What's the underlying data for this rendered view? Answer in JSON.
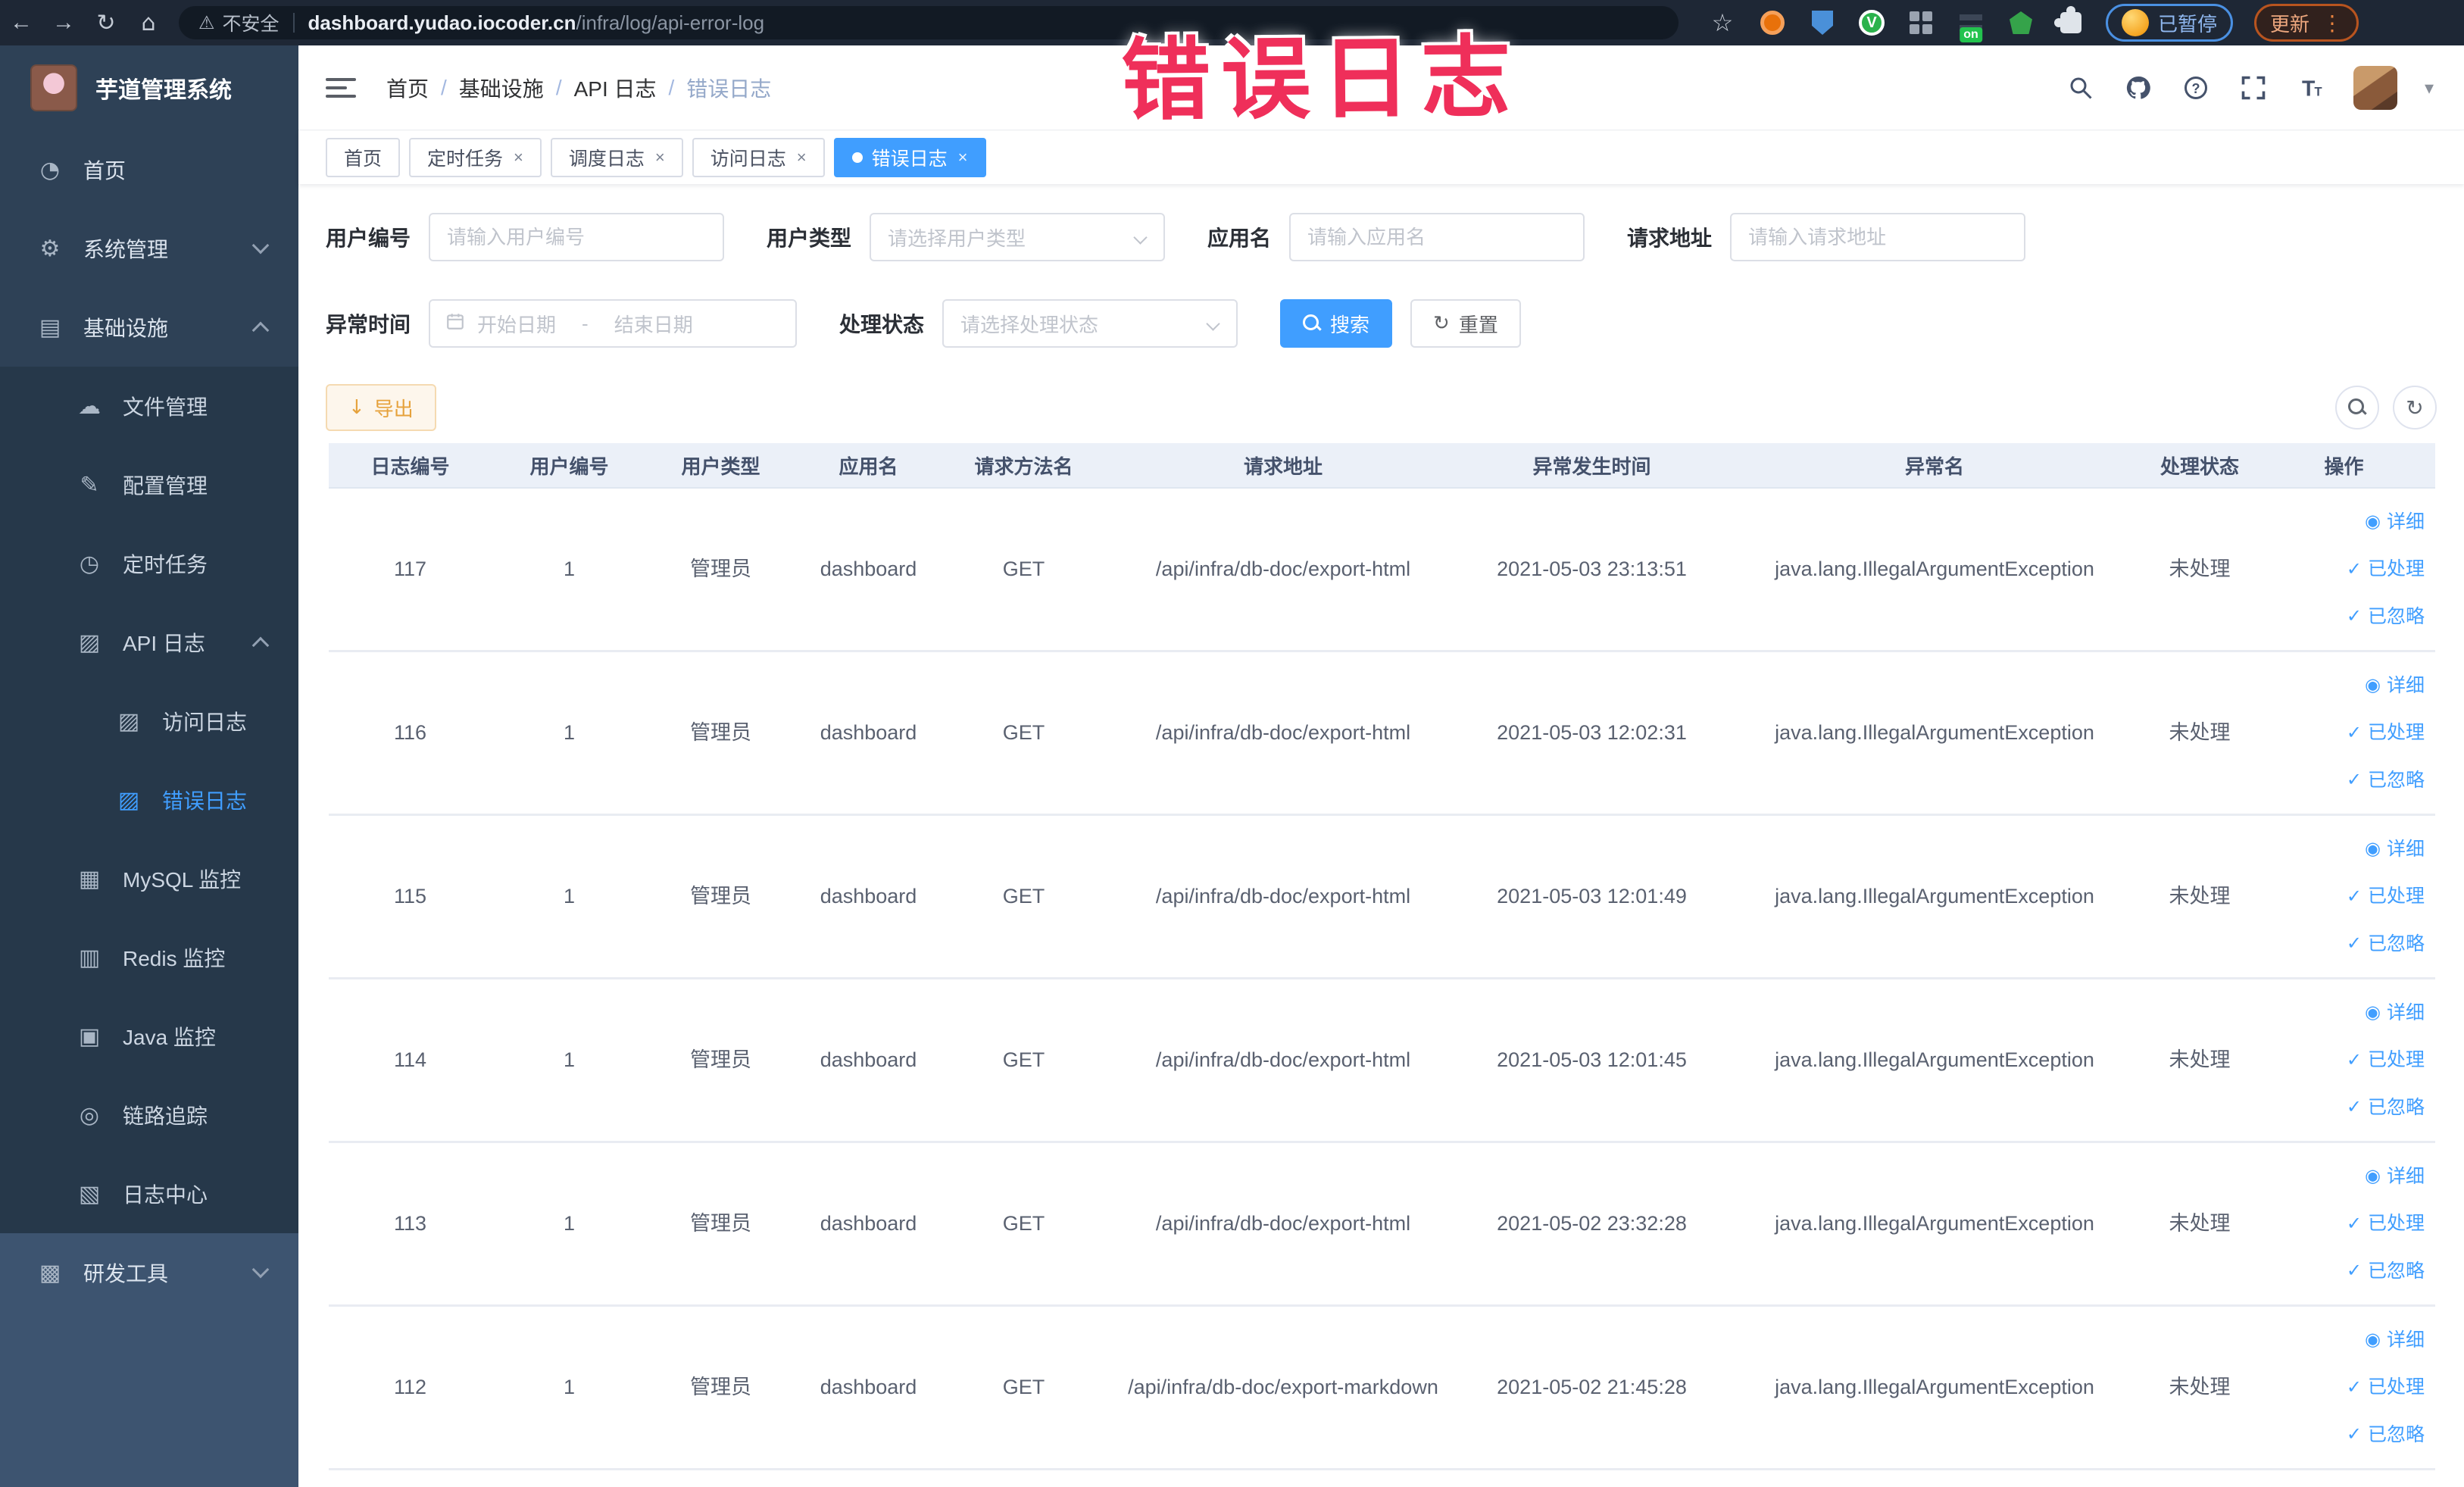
{
  "colors": {
    "accent": "#409eff",
    "warning": "#e6a23c",
    "annotation_red": "#ef2f5a",
    "chrome_bar": "#1e2735",
    "sidebar_dark": "#2e4156",
    "sidebar_submenu": "#26384a",
    "sidebar_light": "#3d5470",
    "table_header_bg": "#ebf0f8"
  },
  "annotation": {
    "text": "错误日志"
  },
  "browser": {
    "security_label": "不安全",
    "url_host": "dashboard.yudao.iocoder.cn",
    "url_path": "/infra/log/api-error-log",
    "extension_on_badge": "on",
    "paused_label": "已暂停",
    "update_label": "更新",
    "kebab": "⋮",
    "back_glyph": "←",
    "forward_glyph": "→",
    "reload_glyph": "↻",
    "home_glyph": "⌂",
    "warning_glyph": "⚠"
  },
  "sidebar": {
    "app_title": "芋道管理系统",
    "items": [
      {
        "key": "home",
        "label": "首页",
        "icon": "dashboard-icon",
        "glyph": "◔",
        "level": 0
      },
      {
        "key": "system-mgmt",
        "label": "系统管理",
        "icon": "gear-icon",
        "glyph": "⚙",
        "level": 0,
        "arrow": "down"
      },
      {
        "key": "infrastructure",
        "label": "基础设施",
        "icon": "infrastructure-icon",
        "glyph": "▤",
        "level": 0,
        "arrow": "up"
      },
      {
        "key": "file-mgmt",
        "label": "文件管理",
        "icon": "cloud-upload-icon",
        "glyph": "☁",
        "level": 1
      },
      {
        "key": "config-mgmt",
        "label": "配置管理",
        "icon": "edit-icon",
        "glyph": "✎",
        "level": 1
      },
      {
        "key": "scheduled-tasks",
        "label": "定时任务",
        "icon": "timer-icon",
        "glyph": "◷",
        "level": 1
      },
      {
        "key": "api-log",
        "label": "API 日志",
        "icon": "api-log-icon",
        "glyph": "▨",
        "level": 1,
        "arrow": "up"
      },
      {
        "key": "access-log",
        "label": "访问日志",
        "icon": "access-log-icon",
        "glyph": "▨",
        "level": 2
      },
      {
        "key": "error-log",
        "label": "错误日志",
        "icon": "error-log-icon",
        "glyph": "▨",
        "level": 2,
        "active": true
      },
      {
        "key": "mysql-monitor",
        "label": "MySQL 监控",
        "icon": "mysql-monitor-icon",
        "glyph": "▦",
        "level": 1
      },
      {
        "key": "redis-monitor",
        "label": "Redis 监控",
        "icon": "redis-monitor-icon",
        "glyph": "▥",
        "level": 1
      },
      {
        "key": "java-monitor",
        "label": "Java 监控",
        "icon": "java-monitor-icon",
        "glyph": "▣",
        "level": 1
      },
      {
        "key": "trace",
        "label": "链路追踪",
        "icon": "trace-eye-icon",
        "glyph": "◎",
        "level": 1
      },
      {
        "key": "log-center",
        "label": "日志中心",
        "icon": "log-center-icon",
        "glyph": "▧",
        "level": 1
      },
      {
        "key": "dev-tools",
        "label": "研发工具",
        "icon": "dev-tools-icon",
        "glyph": "▩",
        "level": 0,
        "arrow": "down",
        "light": true
      }
    ]
  },
  "breadcrumb": {
    "items": [
      "首页",
      "基础设施",
      "API 日志",
      "错误日志"
    ],
    "separator": "/"
  },
  "tabs": {
    "items": [
      {
        "label": "首页",
        "closable": false,
        "active": false
      },
      {
        "label": "定时任务",
        "closable": true,
        "active": false
      },
      {
        "label": "调度日志",
        "closable": true,
        "active": false
      },
      {
        "label": "访问日志",
        "closable": true,
        "active": false
      },
      {
        "label": "错误日志",
        "closable": true,
        "active": true
      }
    ],
    "close_glyph": "×"
  },
  "filters": {
    "user_id": {
      "label": "用户编号",
      "placeholder": "请输入用户编号"
    },
    "user_type": {
      "label": "用户类型",
      "placeholder": "请选择用户类型"
    },
    "app_name": {
      "label": "应用名",
      "placeholder": "请输入应用名"
    },
    "request_url": {
      "label": "请求地址",
      "placeholder": "请输入请求地址"
    },
    "exception_time": {
      "label": "异常时间",
      "start_placeholder": "开始日期",
      "separator": "-",
      "end_placeholder": "结束日期"
    },
    "process_status": {
      "label": "处理状态",
      "placeholder": "请选择处理状态"
    },
    "search_label": "搜索",
    "reset_label": "重置",
    "reset_glyph": "↻"
  },
  "toolbar": {
    "export_label": "导出",
    "export_glyph": "↓",
    "refresh_glyph": "↻"
  },
  "table": {
    "columns": [
      "日志编号",
      "用户编号",
      "用户类型",
      "应用名",
      "请求方法名",
      "请求地址",
      "异常发生时间",
      "异常名",
      "处理状态",
      "操作"
    ],
    "rows": [
      {
        "id": "117",
        "user_id": "1",
        "user_type": "管理员",
        "app_name": "dashboard",
        "method": "GET",
        "url": "/api/infra/db-doc/export-html",
        "time": "2021-05-03 23:13:51",
        "exception": "java.lang.IllegalArgumentException",
        "status": "未处理"
      },
      {
        "id": "116",
        "user_id": "1",
        "user_type": "管理员",
        "app_name": "dashboard",
        "method": "GET",
        "url": "/api/infra/db-doc/export-html",
        "time": "2021-05-03 12:02:31",
        "exception": "java.lang.IllegalArgumentException",
        "status": "未处理"
      },
      {
        "id": "115",
        "user_id": "1",
        "user_type": "管理员",
        "app_name": "dashboard",
        "method": "GET",
        "url": "/api/infra/db-doc/export-html",
        "time": "2021-05-03 12:01:49",
        "exception": "java.lang.IllegalArgumentException",
        "status": "未处理"
      },
      {
        "id": "114",
        "user_id": "1",
        "user_type": "管理员",
        "app_name": "dashboard",
        "method": "GET",
        "url": "/api/infra/db-doc/export-html",
        "time": "2021-05-03 12:01:45",
        "exception": "java.lang.IllegalArgumentException",
        "status": "未处理"
      },
      {
        "id": "113",
        "user_id": "1",
        "user_type": "管理员",
        "app_name": "dashboard",
        "method": "GET",
        "url": "/api/infra/db-doc/export-html",
        "time": "2021-05-02 23:32:28",
        "exception": "java.lang.IllegalArgumentException",
        "status": "未处理"
      },
      {
        "id": "112",
        "user_id": "1",
        "user_type": "管理员",
        "app_name": "dashboard",
        "method": "GET",
        "url": "/api/infra/db-doc/export-markdown",
        "time": "2021-05-02 21:45:28",
        "exception": "java.lang.IllegalArgumentException",
        "status": "未处理"
      }
    ],
    "actions": [
      {
        "key": "detail",
        "label": "详细",
        "icon": "eye-icon",
        "glyph": "◉"
      },
      {
        "key": "process",
        "label": "已处理",
        "icon": "check-icon",
        "glyph": "✓"
      },
      {
        "key": "ignore",
        "label": "已忽略",
        "icon": "check-icon",
        "glyph": "✓"
      }
    ]
  }
}
